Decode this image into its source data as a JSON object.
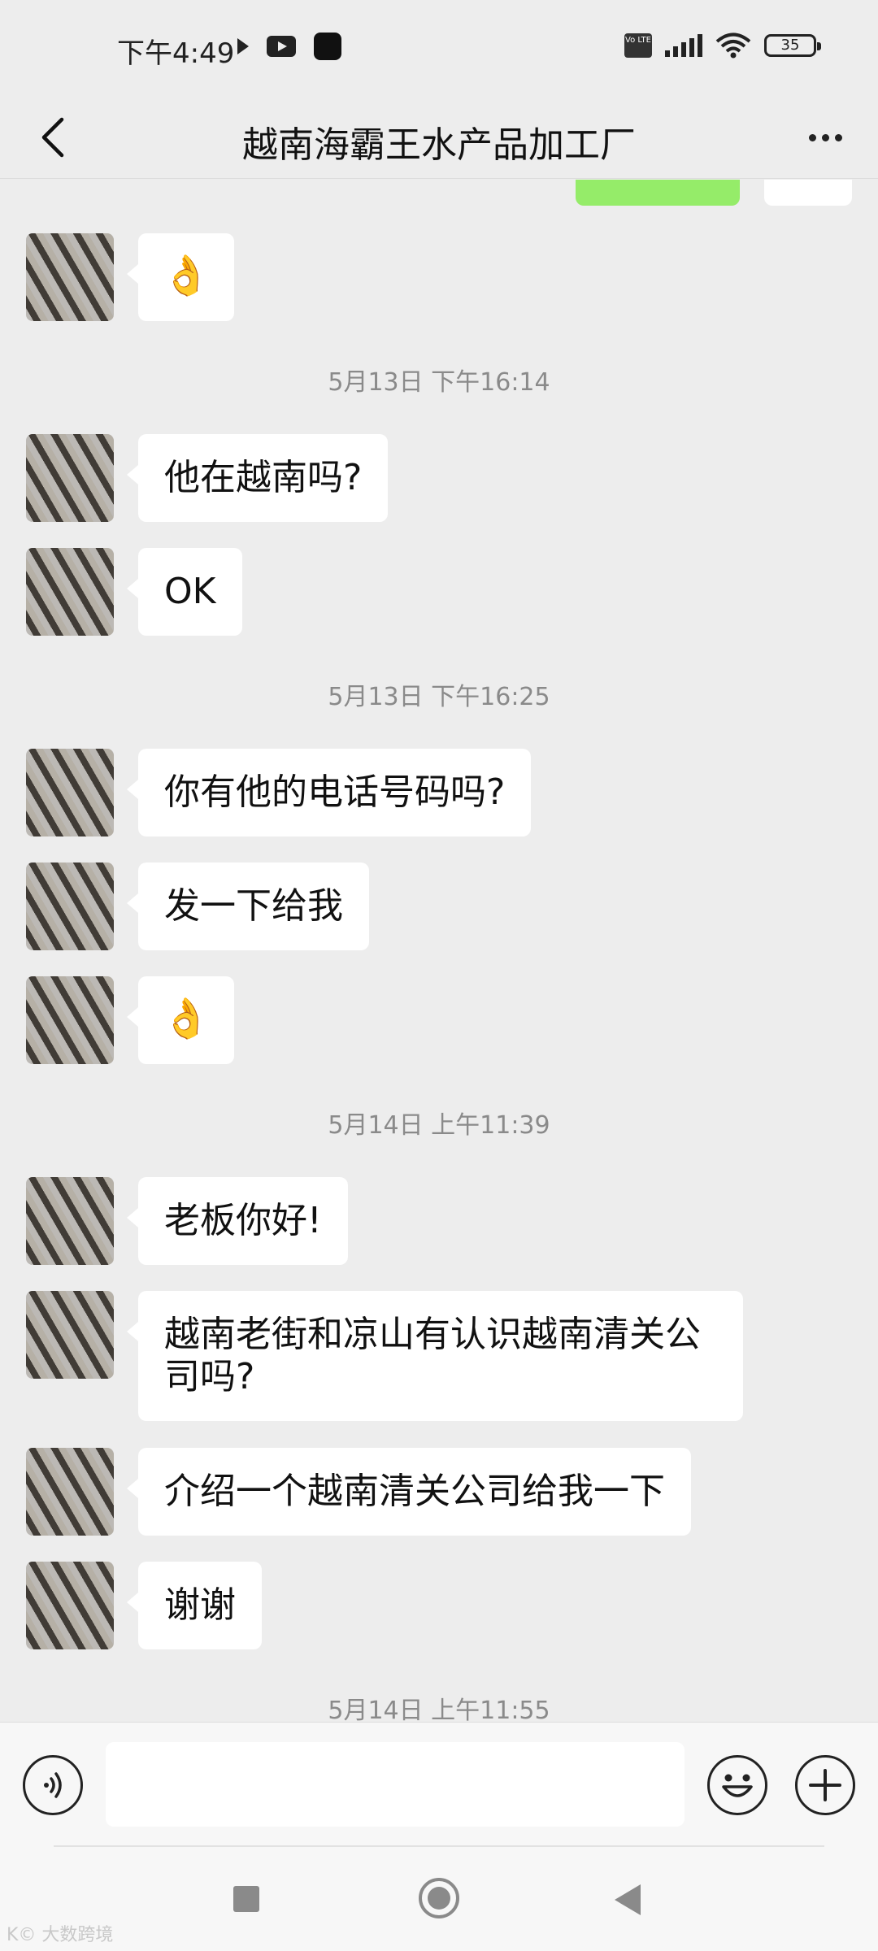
{
  "status_bar": {
    "time": "下午4:49",
    "network_badge": "Vo LTE",
    "battery": "35",
    "icons": [
      "play-icon",
      "youtube-icon",
      "app-icon",
      "volte-icon",
      "signal-icon",
      "wifi-icon",
      "battery-icon"
    ]
  },
  "header": {
    "title": "越南海霸王水产品加工厂",
    "back_icon": "chevron-left-icon",
    "more_icon": "more-dots-icon"
  },
  "messages": [
    {
      "type": "emoji",
      "text": "👌",
      "sender": "contact"
    },
    {
      "type": "timestamp",
      "text": "5月13日 下午16:14"
    },
    {
      "type": "text",
      "text": "他在越南吗?",
      "sender": "contact"
    },
    {
      "type": "text",
      "text": "OK",
      "sender": "contact"
    },
    {
      "type": "timestamp",
      "text": "5月13日 下午16:25"
    },
    {
      "type": "text",
      "text": "你有他的电话号码吗?",
      "sender": "contact"
    },
    {
      "type": "text",
      "text": "发一下给我",
      "sender": "contact"
    },
    {
      "type": "emoji",
      "text": "👌",
      "sender": "contact"
    },
    {
      "type": "timestamp",
      "text": "5月14日 上午11:39"
    },
    {
      "type": "text",
      "text": "老板你好!",
      "sender": "contact"
    },
    {
      "type": "text",
      "text": "越南老街和凉山有认识越南清关公司吗?",
      "sender": "contact"
    },
    {
      "type": "text",
      "text": "介绍一个越南清关公司给我一下",
      "sender": "contact"
    },
    {
      "type": "text",
      "text": "谢谢",
      "sender": "contact"
    },
    {
      "type": "timestamp",
      "text": "5月14日 上午11:55"
    }
  ],
  "input_bar": {
    "value": "",
    "voice_icon": "voice-icon",
    "emoji_icon": "emoji-icon",
    "plus_icon": "plus-icon"
  },
  "nav_bar": {
    "icons": [
      "recent-apps-icon",
      "home-icon",
      "back-icon"
    ]
  },
  "watermark": "K© 大数跨境",
  "colors": {
    "background": "#ededed",
    "bubble_incoming": "#ffffff",
    "bubble_outgoing": "#95ec69",
    "timestamp_text": "#8a8a8a",
    "emoji": "#e8a93a"
  }
}
